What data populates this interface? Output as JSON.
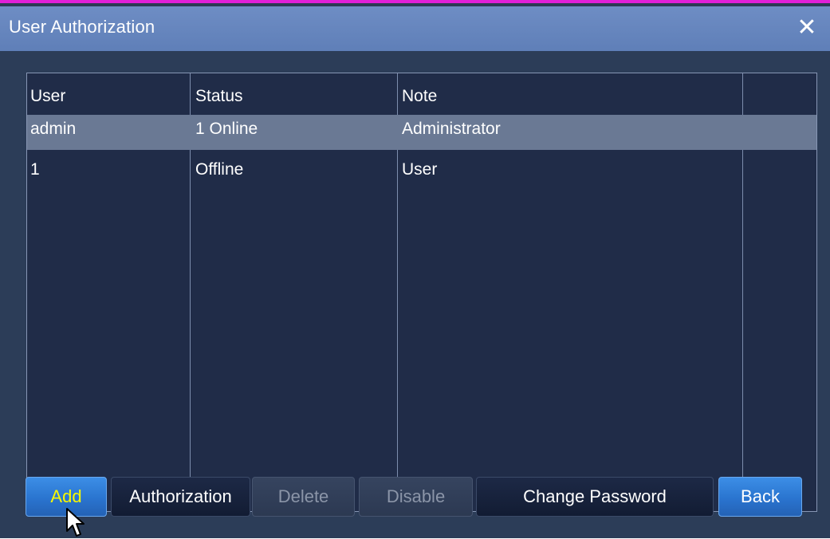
{
  "window": {
    "title": "User  Authorization",
    "close_glyph": "✕"
  },
  "table": {
    "columns": [
      "User",
      "Status",
      "Note"
    ],
    "rows": [
      {
        "user": "admin",
        "status": "1  Online",
        "note": "Administrator",
        "selected": true
      },
      {
        "user": "1",
        "status": "Offline",
        "note": "User",
        "selected": false
      }
    ]
  },
  "buttons": {
    "add": "Add",
    "authorization": "Authorization",
    "delete": "Delete",
    "disable": "Disable",
    "change_password": "Change  Password",
    "back": "Back"
  },
  "colors": {
    "title_bar": "#6e8dc4",
    "window_border": "#e020d8",
    "panel": "#202c48",
    "selected_row": "#6a7994",
    "active_button": "#2a74cf",
    "active_label": "#f8f800"
  },
  "icons": {
    "close": "close-icon",
    "cursor": "mouse-pointer-icon"
  }
}
